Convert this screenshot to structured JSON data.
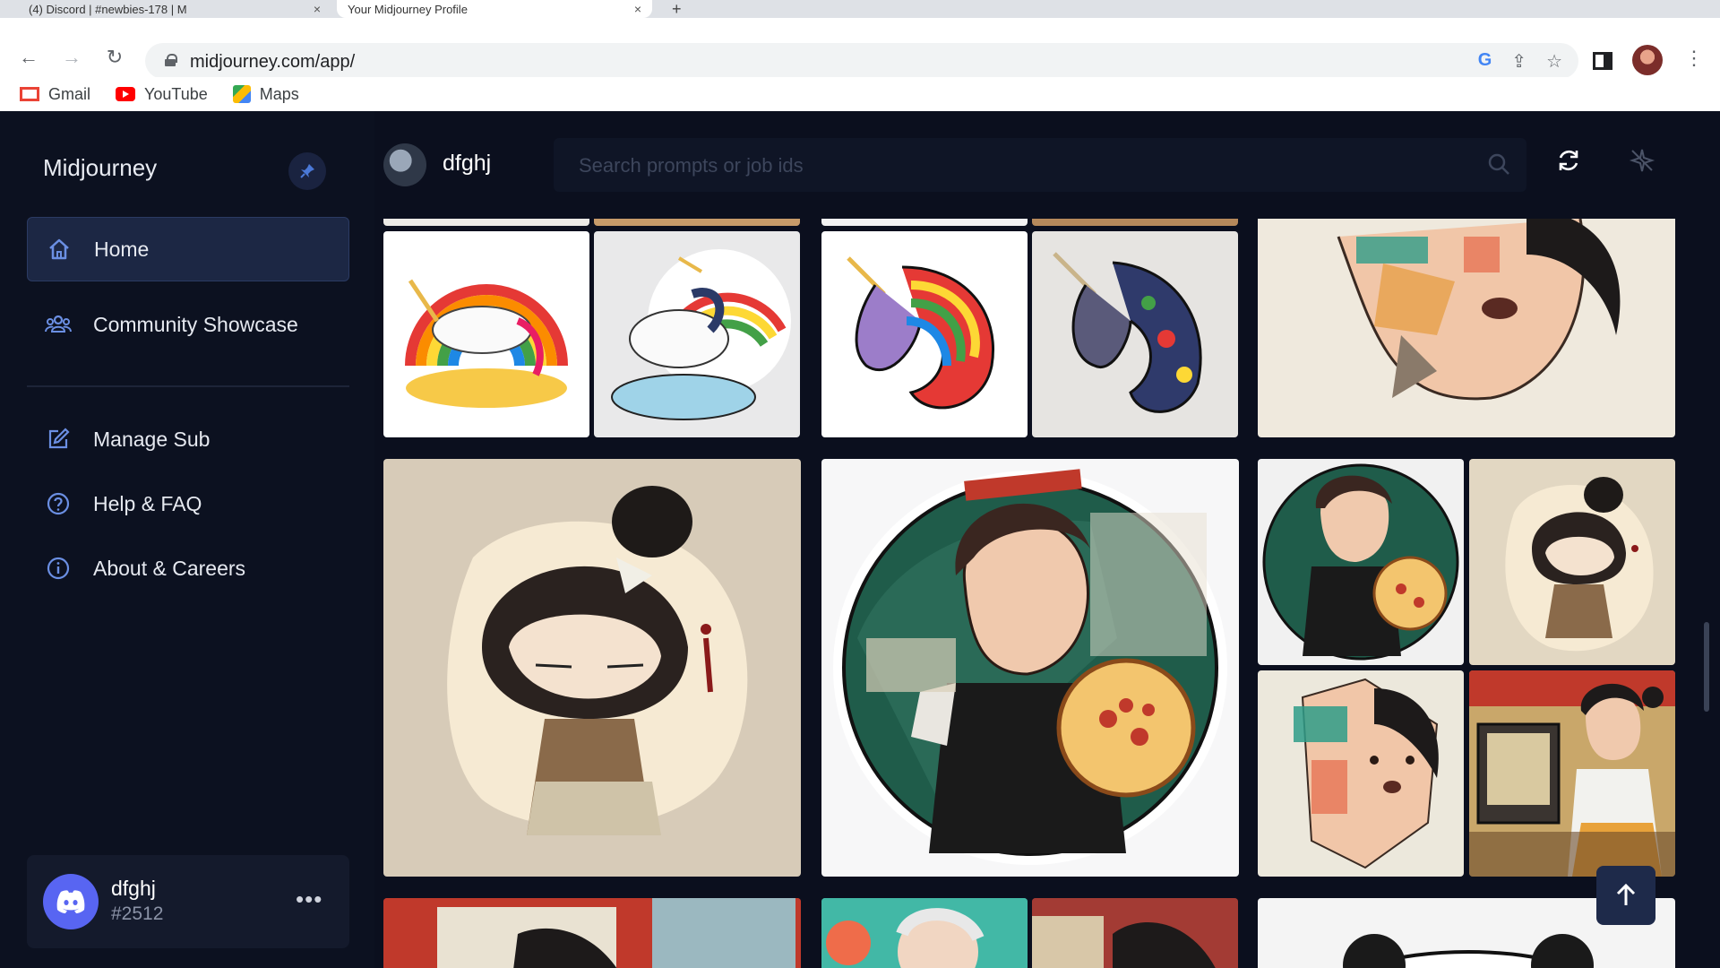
{
  "browser": {
    "tabs": [
      {
        "label": "(4) Discord | #newbies-178 | M"
      },
      {
        "label": "Your Midjourney Profile"
      }
    ],
    "new_tab": "+",
    "close": "×",
    "url": "midjourney.com/app/",
    "bookmarks": [
      {
        "label": "Gmail",
        "icon": "gmail-icon"
      },
      {
        "label": "YouTube",
        "icon": "youtube-icon"
      },
      {
        "label": "Maps",
        "icon": "maps-icon"
      }
    ]
  },
  "sidebar": {
    "brand": "Midjourney",
    "nav": [
      {
        "label": "Home",
        "icon": "home-icon",
        "active": true
      },
      {
        "label": "Community Showcase",
        "icon": "community-icon"
      },
      {
        "label": "Manage Sub",
        "icon": "edit-icon"
      },
      {
        "label": "Help & FAQ",
        "icon": "help-icon"
      },
      {
        "label": "About & Careers",
        "icon": "info-icon"
      }
    ],
    "user": {
      "name": "dfghj",
      "tag": "#2512",
      "menu": "•••"
    }
  },
  "header": {
    "username": "dfghj",
    "search_placeholder": "Search prompts or job ids"
  },
  "gallery": {
    "images": [
      {
        "subject": "rainbow unicord sticker jumping",
        "bg": "#ffffff"
      },
      {
        "subject": "unicorn on cloud with rainbow",
        "bg": "#e9e9ea"
      },
      {
        "subject": "rainbow unicorn head",
        "bg": "#ffffff"
      },
      {
        "subject": "unicorn head splash",
        "bg": "#e6e4e1"
      },
      {
        "subject": "girl face shattered",
        "bg": "#efe9dd"
      },
      {
        "subject": "chibi geisha sticker",
        "bg": "#d7cbb8"
      },
      {
        "subject": "girl with pizza circle",
        "bg": "#f7f7f8"
      },
      {
        "subject": "girl with pizza small",
        "bg": "#f1f1f1"
      },
      {
        "subject": "chibi geisha small",
        "bg": "#e2d7c2"
      },
      {
        "subject": "girl face shattered small",
        "bg": "#ece8dc"
      },
      {
        "subject": "girl at arcade",
        "bg": "#c9a76a"
      }
    ]
  },
  "colors": {
    "app_bg": "#0b0f1e",
    "accent": "#5865f2",
    "active_nav": "#1c2744"
  }
}
